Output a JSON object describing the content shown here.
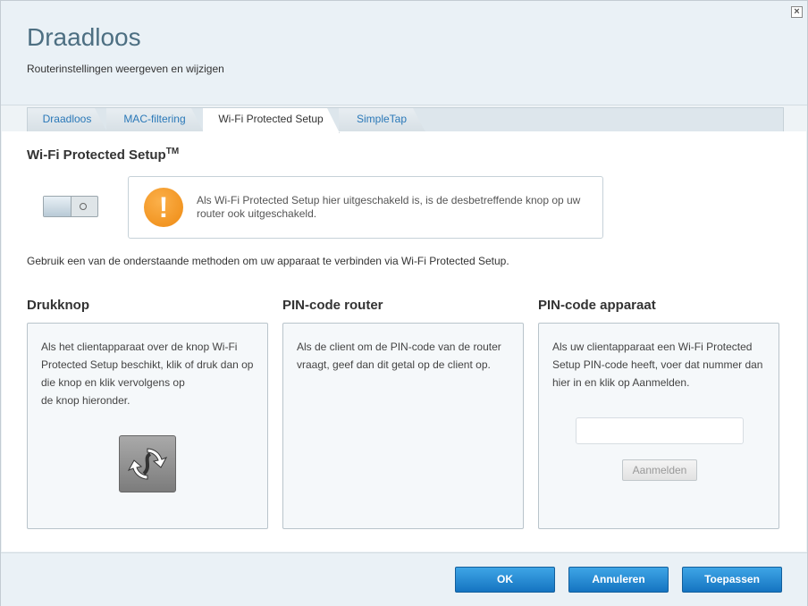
{
  "window": {
    "close_glyph": "×"
  },
  "header": {
    "title": "Draadloos",
    "subtitle": "Routerinstellingen weergeven en wijzigen"
  },
  "tabs": [
    {
      "label": "Draadloos",
      "active": false
    },
    {
      "label": "MAC-filtering",
      "active": false
    },
    {
      "label": "Wi-Fi Protected Setup",
      "active": true
    },
    {
      "label": "SimpleTap",
      "active": false
    }
  ],
  "wps": {
    "title": "Wi-Fi Protected Setup",
    "title_sup": "TM",
    "toggle_on": false,
    "warning_glyph": "!",
    "warning_text": "Als Wi-Fi Protected Setup hier uitgeschakeld is, is de desbetreffende knop op uw router ook uitgeschakeld.",
    "intro": "Gebruik een van de onderstaande methoden om uw apparaat te verbinden via Wi-Fi Protected Setup."
  },
  "columns": {
    "push": {
      "title": "Drukknop",
      "lines": [
        "Als het clientapparaat over de knop Wi-Fi",
        "Protected Setup beschikt, klik of druk dan op",
        "die knop en klik vervolgens op",
        "de knop hieronder."
      ]
    },
    "router_pin": {
      "title": "PIN-code router",
      "lines": [
        "Als de client om de PIN-code van de router",
        "vraagt, geef dan dit getal op de client op."
      ]
    },
    "device_pin": {
      "title": "PIN-code apparaat",
      "lines": [
        "Als uw clientapparaat een Wi-Fi Protected",
        "Setup PIN-code heeft, voer dat nummer dan",
        "hier in en klik op Aanmelden."
      ],
      "input_value": "",
      "login_label": "Aanmelden"
    }
  },
  "footer": {
    "ok": "OK",
    "cancel": "Annuleren",
    "apply": "Toepassen"
  },
  "colors": {
    "title": "#4d6f82",
    "tab_link": "#2a78b8",
    "primary_button": "#1f86d3",
    "warning": "#f39a22"
  }
}
